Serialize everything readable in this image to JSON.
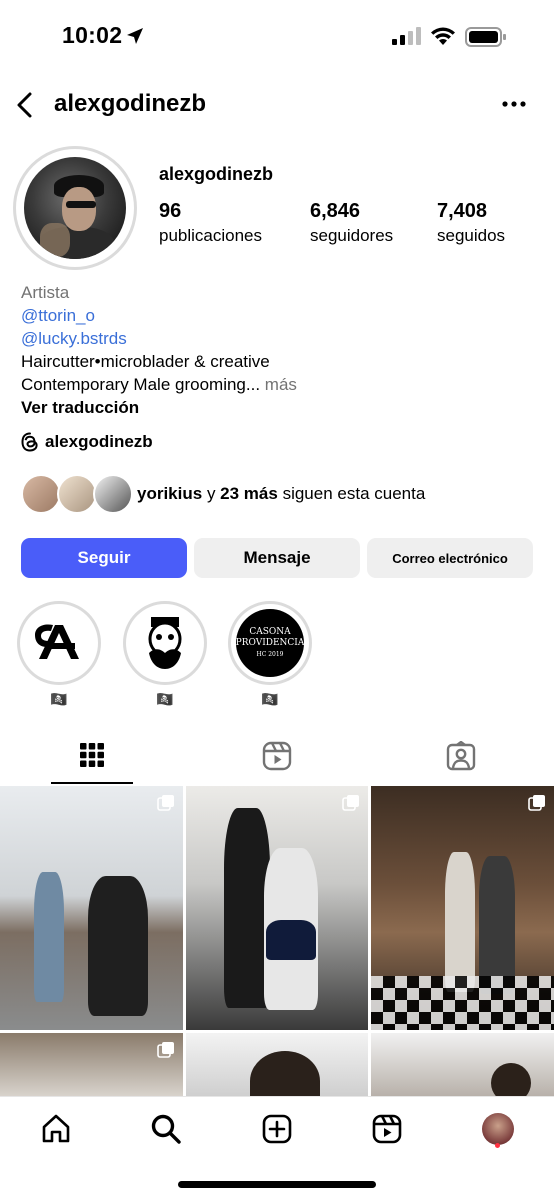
{
  "status_bar": {
    "time": "10:02"
  },
  "header": {
    "username": "alexgodinezb"
  },
  "profile": {
    "username": "alexgodinezb",
    "stats": {
      "posts": {
        "value": "96",
        "label": "publicaciones"
      },
      "followers": {
        "value": "6,846",
        "label": "seguidores"
      },
      "following": {
        "value": "7,408",
        "label": "seguidos"
      }
    },
    "bio": {
      "category": "Artista",
      "mention1": "@ttorin_o",
      "mention2": "@lucky.bstrds",
      "line1": "Haircutter•microblader & creative",
      "line2": "Contemporary Male grooming...",
      "more": "más",
      "translate": "Ver traducción"
    },
    "threads_handle": "alexgodinezb",
    "followed_by": {
      "name": "yorikius",
      "connector": "y",
      "count": "23 más",
      "suffix": "siguen esta cuenta"
    }
  },
  "actions": {
    "follow": "Seguir",
    "message": "Mensaje",
    "email": "Correo electrónico"
  },
  "highlights": [
    {
      "label": "🏴‍☠️"
    },
    {
      "label": "🏴‍☠️"
    },
    {
      "label": "🏴‍☠️",
      "logo_line1": "CASONA",
      "logo_line2": "PROVIDENCIA",
      "logo_line3": "HC 2019"
    }
  ],
  "tabs": {
    "grid_icon": "grid-icon",
    "reels_icon": "reels-icon",
    "tagged_icon": "tagged-icon"
  },
  "colors": {
    "follow_button": "#4a5df9",
    "link": "#3a6fd8",
    "secondary_button": "#efefef",
    "notification_dot": "#ff3040"
  }
}
